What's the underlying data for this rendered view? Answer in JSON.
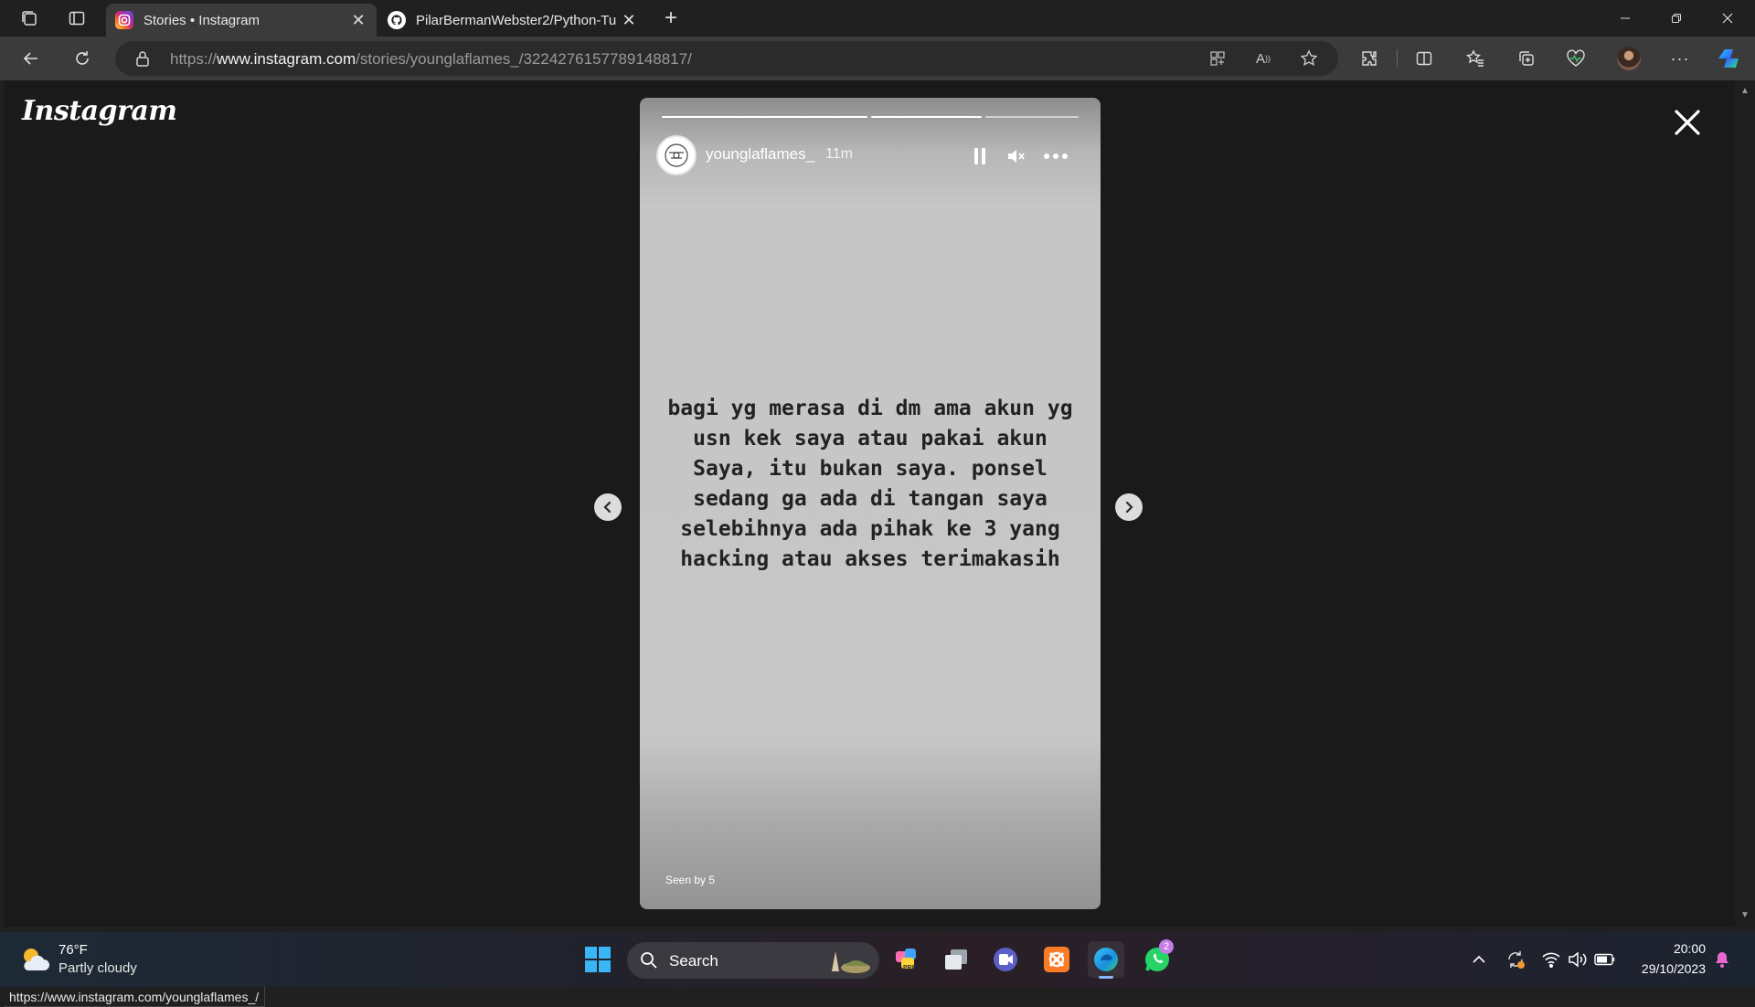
{
  "tabs": [
    {
      "title": "Stories • Instagram",
      "active": true,
      "favicon": "instagram-icon"
    },
    {
      "title": "PilarBermanWebster2/Python-Tu",
      "active": false,
      "favicon": "github-icon"
    }
  ],
  "address_bar": {
    "scheme": "https://",
    "host": "www.instagram.com",
    "path": "/stories/younglaflames_/3224276157789148817/"
  },
  "page": {
    "logo": "Instagram",
    "story": {
      "username": "younglaflames_",
      "time": "11m",
      "progress_segments": [
        1,
        1,
        0
      ],
      "text": "bagi yg merasa di dm ama akun yg usn kek saya atau pakai akun Saya, itu bukan saya. ponsel sedang ga ada di tangan saya selebihnya ada pihak ke 3 yang hacking atau akses terimakasih",
      "seen_by": "Seen by 5"
    }
  },
  "status_bar_url": "https://www.instagram.com/younglaflames_/",
  "taskbar": {
    "weather": {
      "temp": "76°F",
      "desc": "Partly cloudy",
      "icon": "partly-cloudy-icon"
    },
    "search_label": "Search",
    "apps": [
      "copilot-icon",
      "task-view-icon",
      "teams-icon",
      "xampp-icon",
      "edge-icon",
      "whatsapp-icon"
    ],
    "whatsapp_badge": "2",
    "clock": {
      "time": "20:00",
      "date": "29/10/2023"
    }
  },
  "colors": {
    "instagram_gradient": [
      "#feda75",
      "#fa7e1e",
      "#d62976",
      "#962fbf",
      "#4f5bd5"
    ],
    "edge_blue": "#1c8fe0",
    "whatsapp_green": "#25d366"
  }
}
